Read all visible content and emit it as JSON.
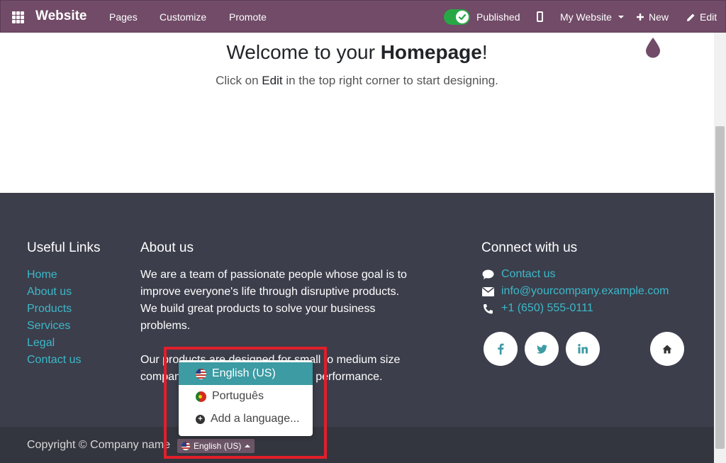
{
  "navbar": {
    "brand": "Website",
    "links": [
      "Pages",
      "Customize",
      "Promote"
    ],
    "published_label": "Published",
    "published": true,
    "my_website": "My Website",
    "new_label": "New",
    "edit_label": "Edit"
  },
  "hero": {
    "title_prefix": "Welcome to your ",
    "title_bold": "Homepage",
    "title_suffix": "!",
    "sub_prefix": "Click on ",
    "sub_strong": "Edit",
    "sub_suffix": " in the top right corner to start designing."
  },
  "footer": {
    "useful_links_title": "Useful Links",
    "useful_links": [
      "Home",
      "About us",
      "Products",
      "Services",
      "Legal",
      "Contact us"
    ],
    "about_title": "About us",
    "about_p1": "We are a team of passionate people whose goal is to improve everyone's life through disruptive products. We build great products to solve your business problems.",
    "about_p2": "Our products are designed for small to medium size companies willing to optimize their performance.",
    "connect_title": "Connect with us",
    "contact_label": "Contact us",
    "email": "info@yourcompany.example.com",
    "phone": "+1 (650) 555-0111",
    "social_icons": [
      "facebook-icon",
      "twitter-icon",
      "linkedin-icon",
      "home-icon"
    ],
    "copyright": "Copyright © Company name",
    "language_button": "English (US)"
  },
  "language_dropdown": {
    "items": [
      {
        "label": "English (US)",
        "flag": "us-flag-icon",
        "active": true
      },
      {
        "label": "Português",
        "flag": "pt-flag-icon",
        "active": false
      }
    ],
    "add_label": "Add a language..."
  },
  "colors": {
    "navbar": "#714B67",
    "footer": "#3c3e4b",
    "link": "#3cb8c9",
    "highlight": "#e11f2b",
    "active_item": "#3c9ba3"
  }
}
